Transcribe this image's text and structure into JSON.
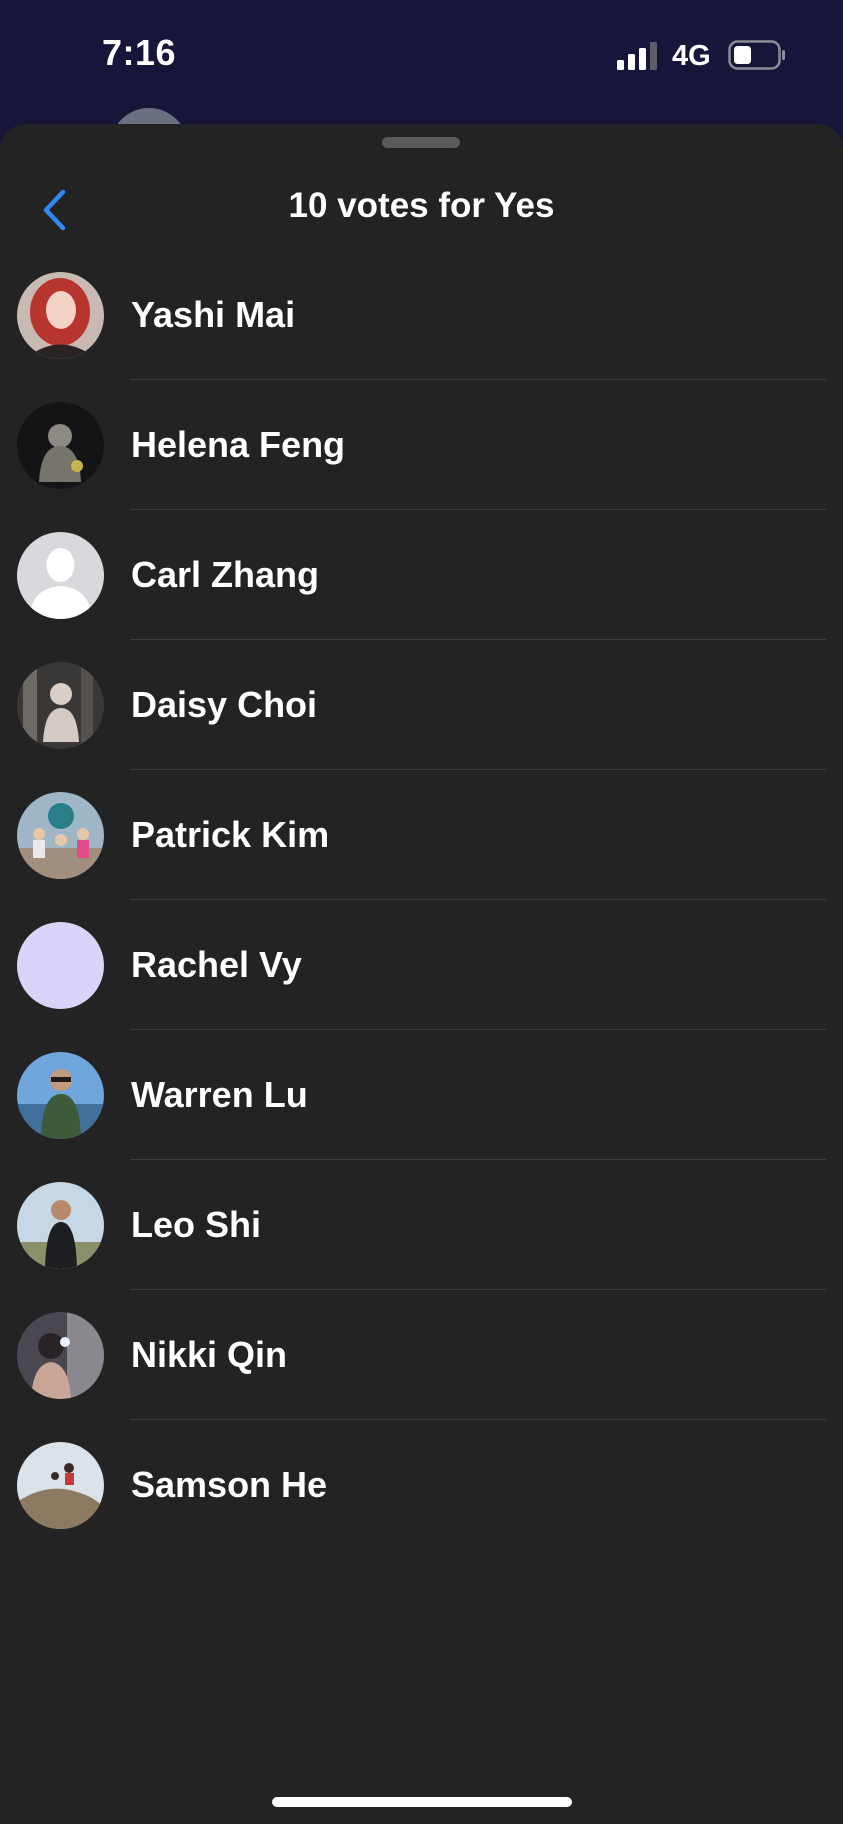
{
  "status_bar": {
    "time": "7:16",
    "network": "4G",
    "icons": [
      "signal-icon",
      "battery-icon"
    ]
  },
  "sheet": {
    "title": "10 votes for Yes",
    "back_icon": "chevron-left-icon"
  },
  "colors": {
    "status_bar_bg": "#17163a",
    "sheet_bg": "#232323",
    "accent": "#2f88f5",
    "separator": "#3b3b3d",
    "text": "#ffffff"
  },
  "voters": [
    {
      "name": "Yashi Mai",
      "avatar": "photo"
    },
    {
      "name": "Helena Feng",
      "avatar": "photo"
    },
    {
      "name": "Carl Zhang",
      "avatar": "default-silhouette"
    },
    {
      "name": "Daisy Choi",
      "avatar": "photo"
    },
    {
      "name": "Patrick Kim",
      "avatar": "photo"
    },
    {
      "name": "Rachel Vy",
      "avatar": "solid-lavender"
    },
    {
      "name": "Warren Lu",
      "avatar": "photo"
    },
    {
      "name": "Leo Shi",
      "avatar": "photo"
    },
    {
      "name": "Nikki Qin",
      "avatar": "photo"
    },
    {
      "name": "Samson He",
      "avatar": "photo"
    }
  ]
}
